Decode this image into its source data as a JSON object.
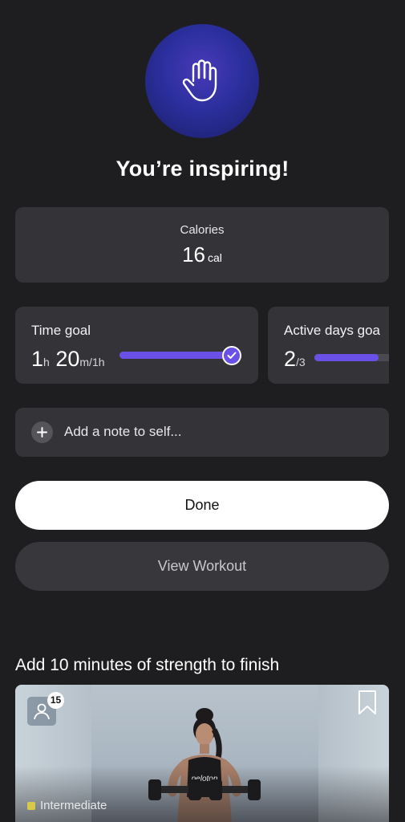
{
  "headline": "You’re inspiring!",
  "calories": {
    "label": "Calories",
    "value": "16",
    "unit": "cal"
  },
  "time_goal": {
    "title": "Time goal",
    "hours": "1",
    "hours_unit": "h",
    "minutes": "20",
    "minutes_unit": "m/1h",
    "progress": 1.0,
    "complete": true
  },
  "active_days_goal": {
    "title": "Active days goa",
    "current": "2",
    "target": "/3",
    "progress": 0.67
  },
  "note": {
    "label": "Add a note to self..."
  },
  "buttons": {
    "done": "Done",
    "view_workout": "View Workout"
  },
  "recommendation": {
    "title": "Add 10 minutes of strength to finish",
    "friends_count": "15",
    "level": "Intermediate",
    "brand": "peloton"
  },
  "colors": {
    "accent": "#6b50e8",
    "background": "#1e1e20",
    "card": "#343438",
    "level": "#d8c94a"
  },
  "icons": [
    "hand-wave-icon",
    "checkmark-icon",
    "plus-icon",
    "person-icon",
    "bookmark-icon"
  ]
}
